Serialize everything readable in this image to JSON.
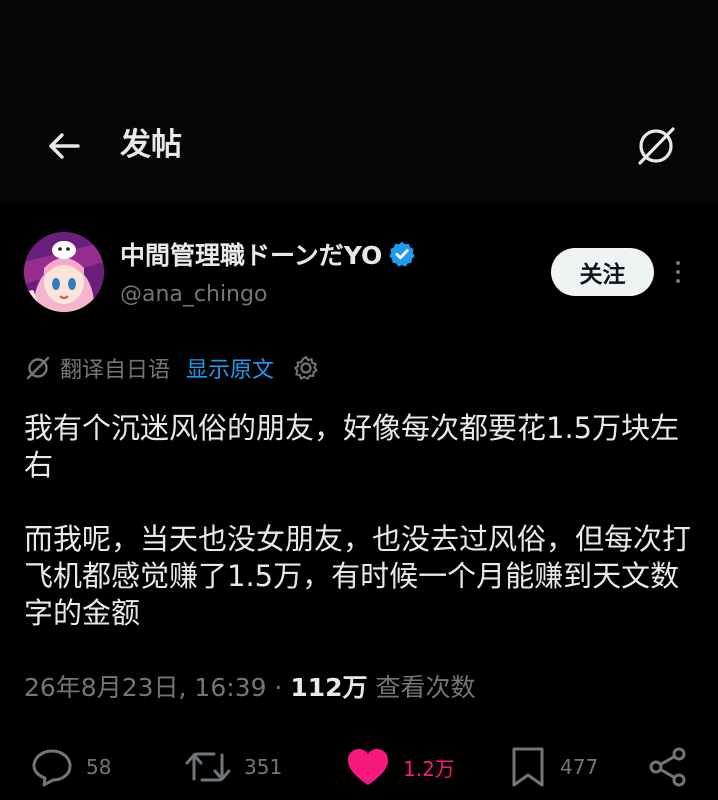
{
  "header": {
    "title": "发帖"
  },
  "author": {
    "display_name": "中間管理職ドーンだYO",
    "handle": "@ana_chingo",
    "follow_label": "关注"
  },
  "translation": {
    "label": "翻译自日语",
    "show_original": "显示原文"
  },
  "tweet": {
    "paragraph_1": "我有个沉迷风俗的朋友，好像每次都要花1.5万块左右",
    "paragraph_2": "而我呢，当天也没女朋友，也没去过风俗，但每次打飞机都感觉赚了1.5万，有时候一个月能赚到天文数字的金额"
  },
  "meta": {
    "datetime": "26年8月23日, 16:39",
    "separator": " · ",
    "views": "112万",
    "views_label": "查看次数"
  },
  "actions": {
    "replies": "58",
    "reposts": "351",
    "likes": "1.2万",
    "bookmarks": "477"
  },
  "colors": {
    "background": "#000000",
    "text": "#e7e9ea",
    "muted": "#71767b",
    "link": "#1d9bf0",
    "like": "#f91880",
    "verified": "#1d9bf0"
  },
  "icons": [
    "back-arrow-icon",
    "translate-icon",
    "verified-badge-icon",
    "more-dots-icon",
    "gear-icon",
    "reply-icon",
    "repost-icon",
    "like-heart-icon",
    "bookmark-icon",
    "share-icon"
  ]
}
